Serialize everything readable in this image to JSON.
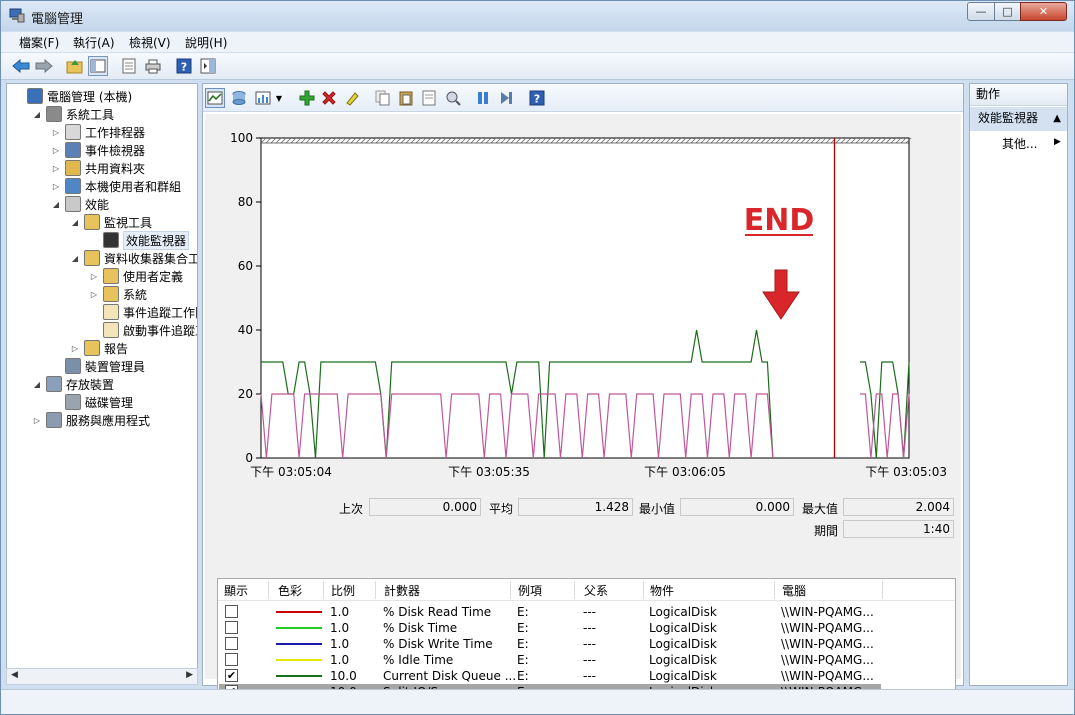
{
  "window": {
    "title": "電腦管理",
    "minimize_glyph": "—",
    "maximize_glyph": "□",
    "close_glyph": "✕"
  },
  "menu": [
    "檔案(F)",
    "執行(A)",
    "檢視(V)",
    "說明(H)"
  ],
  "tree": {
    "items": [
      {
        "label": "電腦管理 (本機)",
        "icon": "computer-icon",
        "expander": "",
        "level": 0
      },
      {
        "label": "系統工具",
        "icon": "tools-icon",
        "expander": "◢",
        "level": 1
      },
      {
        "label": "工作排程器",
        "icon": "clock-icon",
        "expander": "▷",
        "level": 2
      },
      {
        "label": "事件檢視器",
        "icon": "event-viewer-icon",
        "expander": "▷",
        "level": 2
      },
      {
        "label": "共用資料夾",
        "icon": "shared-folder-icon",
        "expander": "▷",
        "level": 2
      },
      {
        "label": "本機使用者和群組",
        "icon": "users-icon",
        "expander": "▷",
        "level": 2
      },
      {
        "label": "效能",
        "icon": "performance-icon",
        "expander": "◢",
        "level": 2
      },
      {
        "label": "監視工具",
        "icon": "folder-icon",
        "expander": "◢",
        "level": 3
      },
      {
        "label": "效能監視器",
        "icon": "monitor-icon",
        "expander": "",
        "level": 4
      },
      {
        "label": "資料收集器集合工具",
        "icon": "folder-icon",
        "expander": "◢",
        "level": 3
      },
      {
        "label": "使用者定義",
        "icon": "folder-user-icon",
        "expander": "▷",
        "level": 4
      },
      {
        "label": "系統",
        "icon": "folder-icon",
        "expander": "▷",
        "level": 4
      },
      {
        "label": "事件追蹤工作階段",
        "icon": "trace-icon",
        "expander": "",
        "level": 4
      },
      {
        "label": "啟動事件追蹤工作階段",
        "icon": "trace-icon",
        "expander": "",
        "level": 4
      },
      {
        "label": "報告",
        "icon": "report-folder-icon",
        "expander": "▷",
        "level": 3
      },
      {
        "label": "裝置管理員",
        "icon": "device-manager-icon",
        "expander": "",
        "level": 2
      },
      {
        "label": "存放裝置",
        "icon": "storage-icon",
        "expander": "◢",
        "level": 1
      },
      {
        "label": "磁碟管理",
        "icon": "disk-icon",
        "expander": "",
        "level": 2
      },
      {
        "label": "服務與應用程式",
        "icon": "services-icon",
        "expander": "▷",
        "level": 1
      }
    ],
    "selected_index": 8
  },
  "chart_data": {
    "type": "line",
    "ylim": [
      0,
      100
    ],
    "yticks": [
      0,
      20,
      40,
      60,
      80,
      100
    ],
    "xticks": [
      "下午 03:05:04",
      "下午 03:05:35",
      "下午 03:06:05",
      "下午 03:05:03"
    ],
    "annotation": "END",
    "series": [
      {
        "color": "#1a6e1a",
        "values": [
          30,
          30,
          30,
          30,
          30,
          20,
          20,
          30,
          30,
          20,
          0,
          30,
          30,
          30,
          30,
          30,
          30,
          30,
          30,
          30,
          30,
          30,
          20,
          0,
          30,
          30,
          30,
          30,
          30,
          30,
          30,
          30,
          30,
          30,
          30,
          30,
          30,
          30,
          30,
          30,
          30,
          30,
          30,
          30,
          30,
          30,
          20,
          30,
          30,
          30,
          30,
          30,
          0,
          30,
          30,
          30,
          30,
          30,
          30,
          30,
          30,
          30,
          30,
          30,
          30,
          30,
          30,
          30,
          30,
          30,
          30,
          30,
          30,
          30,
          30,
          30,
          30,
          30,
          30,
          30,
          40,
          30,
          30,
          30,
          30,
          30,
          30,
          30,
          30,
          30,
          30,
          40,
          30,
          30,
          0,
          null,
          null,
          null,
          null,
          null,
          null,
          null,
          null,
          null,
          null,
          null,
          null,
          null,
          null,
          null,
          30,
          30,
          20,
          0,
          30,
          30,
          30,
          20,
          0,
          30
        ]
      },
      {
        "color": "#c0569a",
        "values": [
          20,
          0,
          20,
          20,
          20,
          20,
          20,
          0,
          20,
          20,
          20,
          20,
          20,
          20,
          20,
          0,
          20,
          20,
          20,
          20,
          20,
          20,
          20,
          0,
          20,
          20,
          20,
          20,
          20,
          20,
          20,
          20,
          20,
          20,
          0,
          20,
          20,
          20,
          20,
          20,
          20,
          0,
          20,
          20,
          20,
          0,
          20,
          20,
          20,
          20,
          0,
          20,
          20,
          20,
          20,
          0,
          20,
          20,
          20,
          0,
          20,
          20,
          20,
          0,
          20,
          20,
          20,
          20,
          0,
          20,
          20,
          20,
          20,
          0,
          20,
          20,
          20,
          20,
          0,
          20,
          20,
          20,
          0,
          20,
          20,
          20,
          0,
          20,
          20,
          20,
          0,
          20,
          20,
          20,
          0,
          null,
          null,
          null,
          null,
          null,
          null,
          null,
          null,
          null,
          null,
          null,
          null,
          null,
          null,
          null,
          20,
          20,
          0,
          20,
          20,
          0,
          20,
          20,
          0,
          20
        ]
      }
    ],
    "current_time_marker": 0.885
  },
  "stats": {
    "last_label": "上次",
    "last_value": "0.000",
    "avg_label": "平均",
    "avg_value": "1.428",
    "min_label": "最小值",
    "min_value": "0.000",
    "max_label": "最大值",
    "max_value": "2.004",
    "duration_label": "期間",
    "duration_value": "1:40"
  },
  "counters": {
    "headers": [
      "顯示",
      "色彩",
      "比例",
      "計數器",
      "例項",
      "父系",
      "物件",
      "電腦"
    ],
    "rows": [
      {
        "show": false,
        "color": "#cc0000",
        "scale": "1.0",
        "counter": "% Disk Read Time",
        "instance": "E:",
        "parent": "---",
        "object": "LogicalDisk",
        "computer": "\\\\WIN-PQAMG...",
        "selected": false
      },
      {
        "show": false,
        "color": "#22cc22",
        "scale": "1.0",
        "counter": "% Disk Time",
        "instance": "E:",
        "parent": "---",
        "object": "LogicalDisk",
        "computer": "\\\\WIN-PQAMG...",
        "selected": false
      },
      {
        "show": false,
        "color": "#1a1aaa",
        "scale": "1.0",
        "counter": "% Disk Write Time",
        "instance": "E:",
        "parent": "---",
        "object": "LogicalDisk",
        "computer": "\\\\WIN-PQAMG...",
        "selected": false
      },
      {
        "show": false,
        "color": "#e6e600",
        "scale": "1.0",
        "counter": "% Idle Time",
        "instance": "E:",
        "parent": "---",
        "object": "LogicalDisk",
        "computer": "\\\\WIN-PQAMG...",
        "selected": false
      },
      {
        "show": true,
        "color": "#1a6e1a",
        "scale": "10.0",
        "counter": "Current Disk Queue ...",
        "instance": "E:",
        "parent": "---",
        "object": "LogicalDisk",
        "computer": "\\\\WIN-PQAMG...",
        "selected": false
      },
      {
        "show": true,
        "color": "#c0569a",
        "scale": "10.0",
        "counter": "Split IO/Sec",
        "instance": "E:",
        "parent": "---",
        "object": "LogicalDisk",
        "computer": "\\\\WIN-PQAMG...",
        "selected": true
      }
    ],
    "check_glyph": "✔"
  },
  "actions": {
    "header": "動作",
    "section": "效能監視器",
    "section_glyph": "▲",
    "more": "其他...",
    "more_glyph": "▶"
  },
  "scroll": {
    "left_glyph": "◀",
    "right_glyph": "▶"
  },
  "colors": {
    "accent": "#d9262b",
    "selection": "#a6a6a6"
  }
}
